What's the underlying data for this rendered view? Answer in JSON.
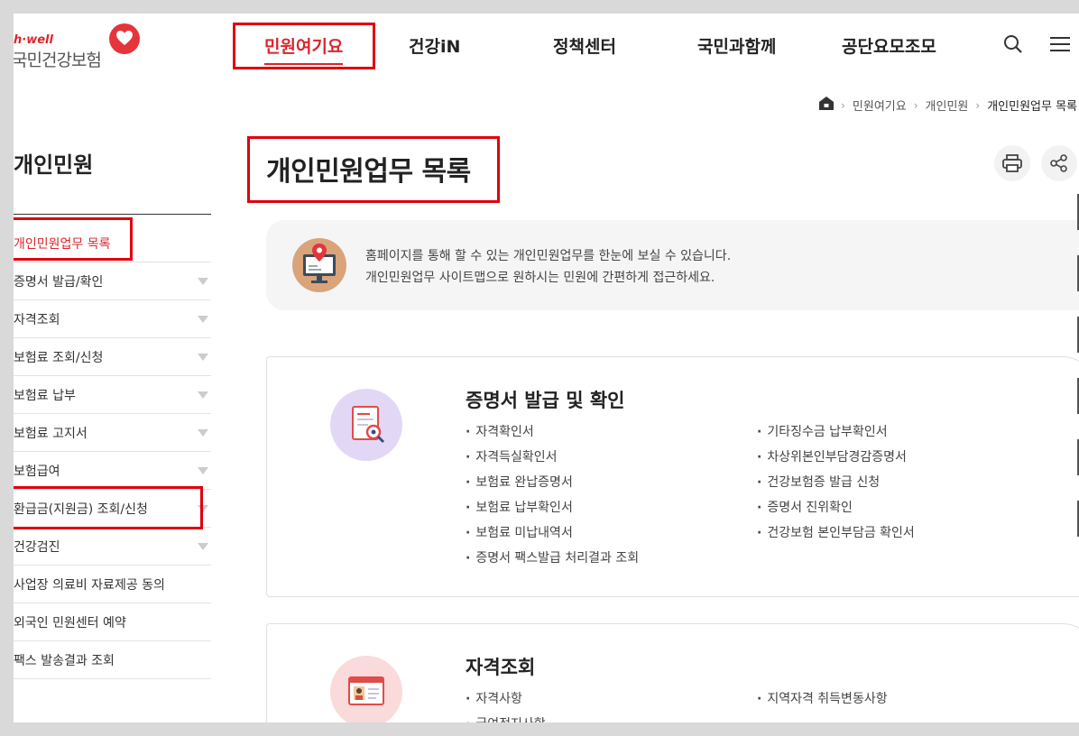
{
  "header": {
    "logo_sub": "h·well",
    "logo_main": "국민건강보험",
    "nav": [
      "민원여기요",
      "건강iN",
      "정책센터",
      "국민과함께",
      "공단요모조모"
    ],
    "search_icon": "search-icon",
    "menu_icon": "hamburger-icon"
  },
  "breadcrumb": {
    "home_icon": "home-icon",
    "items": [
      "민원여기요",
      "개인민원",
      "개인민원업무 목록"
    ]
  },
  "sidebar": {
    "title": "개인민원",
    "items": [
      {
        "label": "개인민원업무 목록"
      },
      {
        "label": "증명서 발급/확인"
      },
      {
        "label": "자격조회"
      },
      {
        "label": "보험료 조회/신청"
      },
      {
        "label": "보험료 납부"
      },
      {
        "label": "보험료 고지서"
      },
      {
        "label": "보험급여"
      },
      {
        "label": "환급금(지원금) 조회/신청"
      },
      {
        "label": "건강검진"
      },
      {
        "label": "사업장 의료비 자료제공 동의"
      },
      {
        "label": "외국인 민원센터 예약"
      },
      {
        "label": "팩스 발송결과 조회"
      }
    ]
  },
  "main": {
    "title": "개인민원업무 목록",
    "print_icon": "printer-icon",
    "share_icon": "share-icon",
    "intro": {
      "line1": "홈페이지를 통해 할 수 있는 개인민원업무를 한눈에 보실 수 있습니다.",
      "line2": "개인민원업무 사이트맵으로 원하시는 민원에 간편하게 접근하세요."
    },
    "cards": [
      {
        "title": "증명서 발급 및 확인",
        "left": [
          "자격확인서",
          "자격득실확인서",
          "보험료 완납증명서",
          "보험료 납부확인서",
          "보험료 미납내역서",
          "증명서 팩스발급 처리결과 조회"
        ],
        "right": [
          "기타징수금 납부확인서",
          "차상위본인부담경감증명서",
          "건강보험증 발급 신청",
          "증명서 진위확인",
          "건강보험 본인부담금 확인서"
        ]
      },
      {
        "title": "자격조회",
        "left": [
          "자격사항",
          "급여정지사항"
        ],
        "right": [
          "지역자격 취득변동사항"
        ]
      }
    ]
  },
  "colors": {
    "brand_red": "#d9262c",
    "highlight_box": "#e0000d",
    "card1_icon_bg": "#e2d8f6",
    "card2_icon_bg": "#fadada"
  }
}
